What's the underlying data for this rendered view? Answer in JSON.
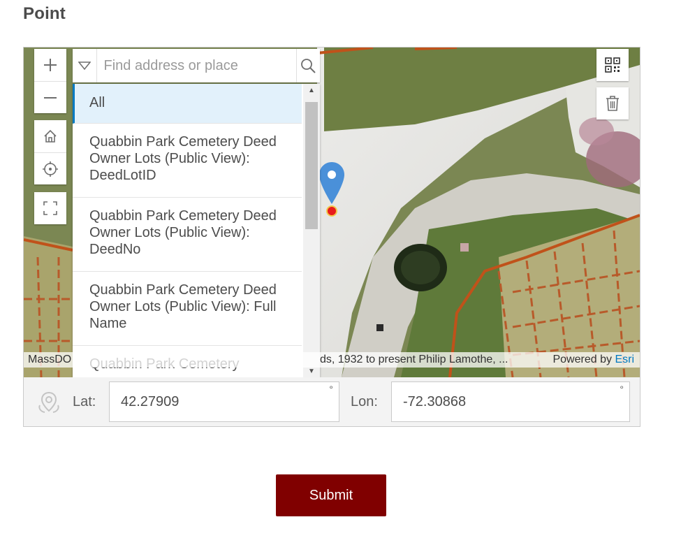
{
  "section": {
    "title": "Point"
  },
  "map": {
    "controls": {
      "zoom_in_icon": "plus-icon",
      "zoom_out_icon": "minus-icon",
      "home_icon": "home-icon",
      "locate_icon": "crosshair-icon",
      "fullscreen_icon": "expand-icon",
      "qr_icon": "qr-code-icon",
      "delete_icon": "trash-icon"
    },
    "search": {
      "placeholder": "Find address or place",
      "sources": [
        {
          "label": "All",
          "selected": true
        },
        {
          "label": "Quabbin Park Cemetery Deed Owner Lots (Public View): DeedLotID"
        },
        {
          "label": "Quabbin Park Cemetery Deed Owner Lots (Public View): DeedNo"
        },
        {
          "label": "Quabbin Park Cemetery Deed Owner Lots (Public View): Full Name"
        },
        {
          "label": "Quabbin Park Cemetery"
        }
      ]
    },
    "attribution": {
      "left": "MassDO",
      "middle": "ds, 1932 to present Philip Lamothe, ...",
      "powered_by": "Powered by",
      "esri": "Esri"
    },
    "colors": {
      "parcel_lines": "#c0521a",
      "pin": "#4a90d9",
      "pin_dot": "#e81c1c"
    }
  },
  "coordinates": {
    "lat_label": "Lat:",
    "lat_value": "42.27909",
    "lon_label": "Lon:",
    "lon_value": "-72.30868",
    "degree_symbol": "°"
  },
  "form": {
    "submit_label": "Submit",
    "submit_color": "#800000"
  }
}
